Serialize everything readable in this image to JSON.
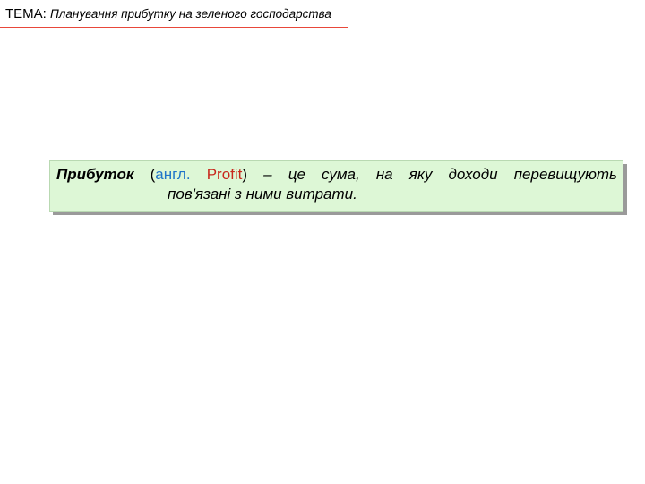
{
  "header": {
    "prefix": "ТЕМА:",
    "topic": "Планування прибутку на зеленого господарства"
  },
  "definition": {
    "term": "Прибуток",
    "open_paren": "(",
    "lang_label": "англ.",
    "english_word": "Profit",
    "close_paren": ")",
    "line1_rest": " – це сума, на яку доходи перевищують",
    "line2": "пов'язані з ними витрати."
  },
  "colors": {
    "header_rule": "#e8483a",
    "box_background": "#ddf7d6",
    "box_shadow": "#9a9a9a",
    "lang_label": "#1f74c9",
    "english_word": "#c8281c"
  }
}
